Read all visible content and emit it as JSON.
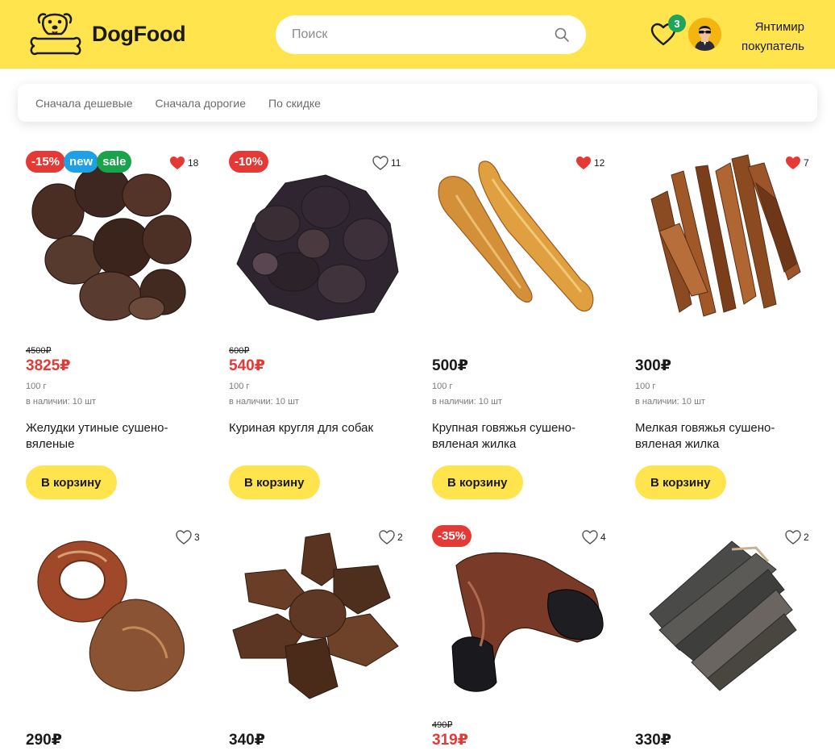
{
  "header": {
    "brand": "DogFood",
    "search_placeholder": "Поиск",
    "favorites_count": "3",
    "user_name": "Янтимир",
    "user_role": "покупатель"
  },
  "sort": {
    "options": [
      "Сначала дешевые",
      "Сначала дорогие",
      "По скидке"
    ]
  },
  "products": [
    {
      "old_price": "4500₽",
      "price": "3825₽",
      "discount": "-15%",
      "tags": [
        "new",
        "sale"
      ],
      "likes": "18",
      "liked": true,
      "weight": "100 г",
      "stock": "в наличии: 10 шт",
      "name": "Желудки утиные сушено-вяленые",
      "cart": "В корзину"
    },
    {
      "old_price": "600₽",
      "price": "540₽",
      "discount": "-10%",
      "tags": [],
      "likes": "11",
      "liked": false,
      "weight": "100 г",
      "stock": "в наличии: 10 шт",
      "name": "Куриная кругля для собак",
      "cart": "В корзину"
    },
    {
      "old_price": "",
      "price": "500₽",
      "discount": "",
      "tags": [],
      "likes": "12",
      "liked": true,
      "weight": "100 г",
      "stock": "в наличии: 10 шт",
      "name": "Крупная говяжья сушено-вяленая жилка",
      "cart": "В корзину"
    },
    {
      "old_price": "",
      "price": "300₽",
      "discount": "",
      "tags": [],
      "likes": "7",
      "liked": true,
      "weight": "100 г",
      "stock": "в наличии: 10 шт",
      "name": "Мелкая говяжья сушено-вяленая жилка",
      "cart": "В корзину"
    },
    {
      "old_price": "",
      "price": "290₽",
      "discount": "",
      "tags": [],
      "likes": "3",
      "liked": false
    },
    {
      "old_price": "",
      "price": "340₽",
      "discount": "",
      "tags": [],
      "likes": "2",
      "liked": false
    },
    {
      "old_price": "490₽",
      "price": "319₽",
      "discount": "-35%",
      "tags": [],
      "likes": "4",
      "liked": false
    },
    {
      "old_price": "",
      "price": "330₽",
      "discount": "",
      "tags": [],
      "likes": "2",
      "liked": false
    }
  ],
  "colors": {
    "header_bg": "#FFE44D",
    "accent_red": "#e53935",
    "badge_new": "#1ea0e6",
    "badge_sale": "#19a34a",
    "fav_badge": "#1fa45a"
  }
}
